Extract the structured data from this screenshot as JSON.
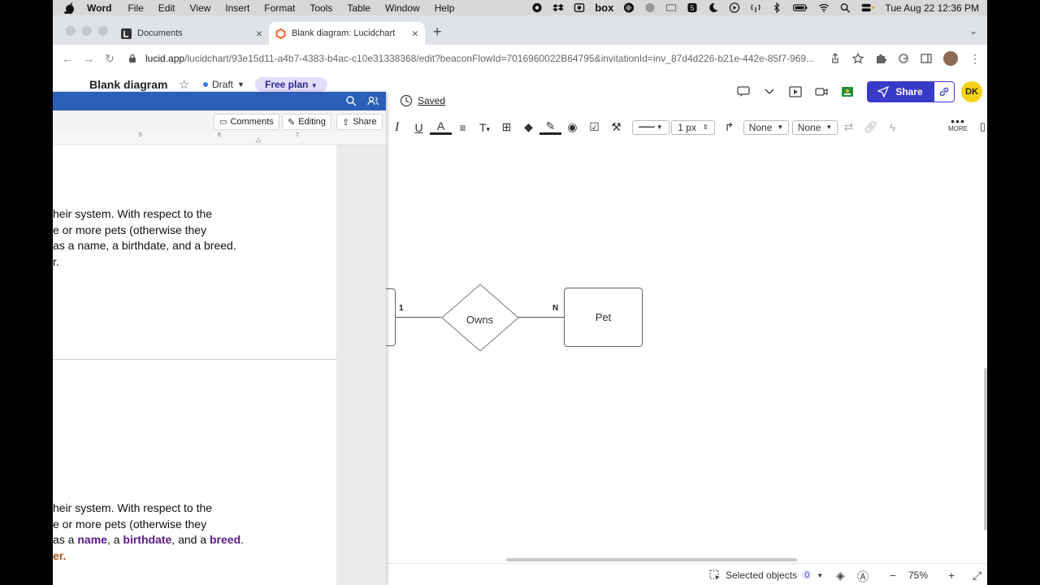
{
  "menubar": {
    "app": "Word",
    "items": [
      "File",
      "Edit",
      "View",
      "Insert",
      "Format",
      "Tools",
      "Table",
      "Window",
      "Help"
    ],
    "datetime": "Tue Aug 22  12:36 PM",
    "box_label": "box"
  },
  "browser": {
    "tabs": [
      {
        "label": "Documents"
      },
      {
        "label": "Blank diagram: Lucidchart"
      }
    ],
    "url_host": "lucid.app",
    "url_path": "/lucidchart/93e15d11-a4b7-4383-b4ac-c10e31338368/edit?beaconFlowId=7016960022B64795&invitationId=inv_87d4d226-b21e-442e-85f7-969..."
  },
  "lucid": {
    "doc_title": "Blank diagram",
    "status": "Draft",
    "plan_badge": "Free plan",
    "saved": "Saved",
    "share": "Share",
    "user_initials": "DK",
    "accent": "#3a3ac9",
    "toolbar": {
      "line_width": "1 px",
      "start_arrow": "None",
      "end_arrow": "None",
      "more": "MORE"
    },
    "diagram": {
      "relationship": "Owns",
      "entity": "Pet",
      "card_left": "1",
      "card_right": "N"
    },
    "footer": {
      "selected_label": "Selected objects",
      "selected_count": "0",
      "zoom": "75%"
    }
  },
  "word": {
    "titlebar_color": "#2b5fb8",
    "ribbon": {
      "comments": "Comments",
      "editing": "Editing",
      "share": "Share"
    },
    "ruler": [
      "5",
      "6",
      "7"
    ],
    "para1": [
      "heir system.  With respect to the",
      "e or more pets (otherwise they",
      "as a name, a birthdate, and a breed.",
      "r."
    ],
    "para2": {
      "line1": "heir system.  With respect to the",
      "line2": "e or more pets (otherwise they",
      "line3_a": "as a ",
      "line3_name": "name",
      "line3_b": ", a ",
      "line3_birthdate": "birthdate",
      "line3_c": ", and a ",
      "line3_breed": "breed",
      "line3_d": ".",
      "line4": "er."
    }
  }
}
